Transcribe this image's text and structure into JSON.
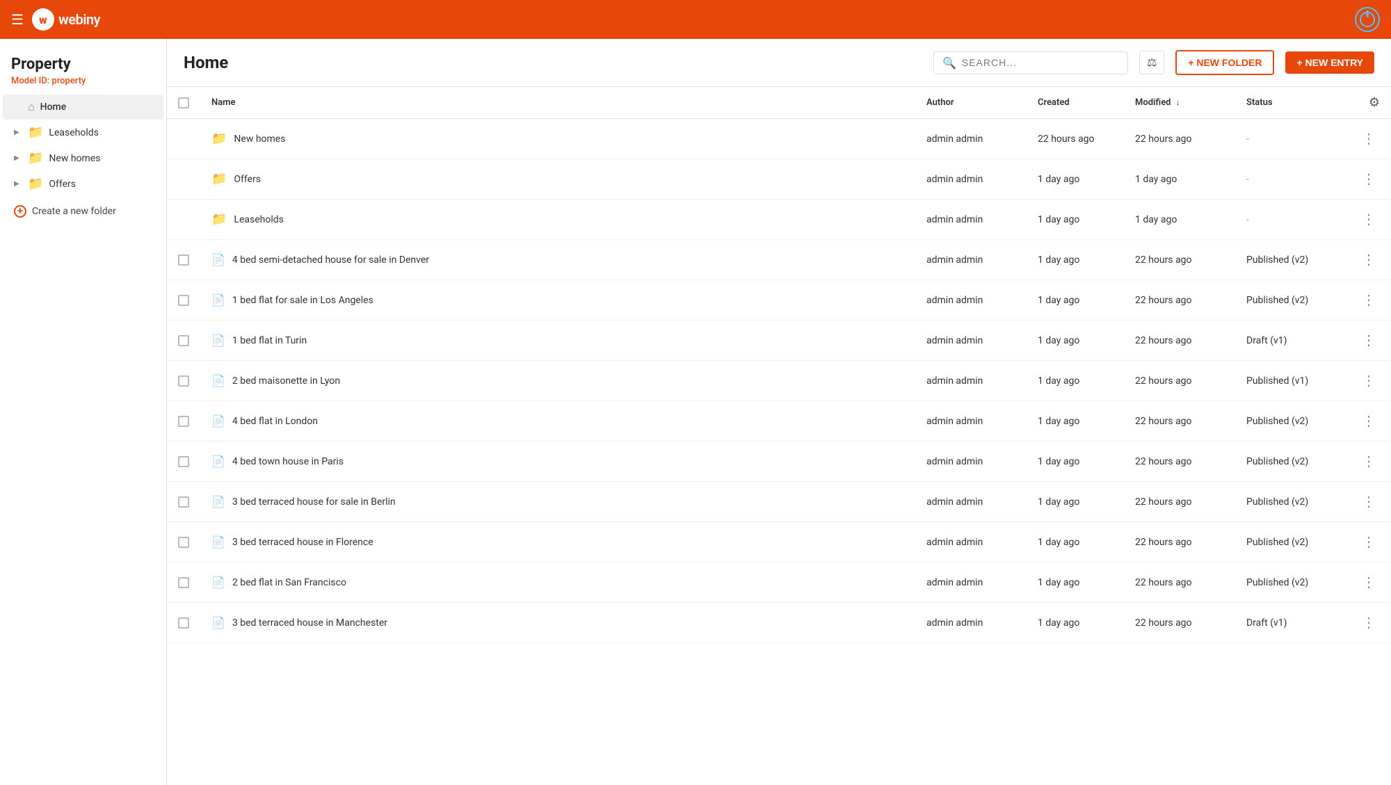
{
  "app": {
    "nav": {
      "logo_letter": "w",
      "logo_text": "webiny"
    }
  },
  "sidebar": {
    "title": "Property",
    "model_label": "Model ID:",
    "model_id": "property",
    "items": [
      {
        "id": "home",
        "label": "Home",
        "icon": "home",
        "active": true
      },
      {
        "id": "leaseholds",
        "label": "Leaseholds",
        "icon": "folder",
        "active": false
      },
      {
        "id": "new-homes",
        "label": "New homes",
        "icon": "folder",
        "active": false
      },
      {
        "id": "offers",
        "label": "Offers",
        "icon": "folder",
        "active": false
      }
    ],
    "create_folder_label": "Create a new folder"
  },
  "header": {
    "title": "Home",
    "search_placeholder": "SEARCH...",
    "btn_new_folder": "+ NEW FOLDER",
    "btn_new_entry": "+ NEW ENTRY"
  },
  "table": {
    "columns": {
      "name": "Name",
      "author": "Author",
      "created": "Created",
      "modified": "Modified",
      "status": "Status"
    },
    "folders": [
      {
        "id": "f1",
        "name": "New homes",
        "author": "admin admin",
        "created": "22 hours ago",
        "modified": "22 hours ago",
        "status": "-"
      },
      {
        "id": "f2",
        "name": "Offers",
        "author": "admin admin",
        "created": "1 day ago",
        "modified": "1 day ago",
        "status": "-"
      },
      {
        "id": "f3",
        "name": "Leaseholds",
        "author": "admin admin",
        "created": "1 day ago",
        "modified": "1 day ago",
        "status": "-"
      }
    ],
    "entries": [
      {
        "id": "e1",
        "name": "4 bed semi-detached house for sale in Denver",
        "author": "admin admin",
        "created": "1 day ago",
        "modified": "22 hours ago",
        "status": "Published (v2)"
      },
      {
        "id": "e2",
        "name": "1 bed flat for sale in Los Angeles",
        "author": "admin admin",
        "created": "1 day ago",
        "modified": "22 hours ago",
        "status": "Published (v2)"
      },
      {
        "id": "e3",
        "name": "1 bed flat in Turin",
        "author": "admin admin",
        "created": "1 day ago",
        "modified": "22 hours ago",
        "status": "Draft (v1)"
      },
      {
        "id": "e4",
        "name": "2 bed maisonette in Lyon",
        "author": "admin admin",
        "created": "1 day ago",
        "modified": "22 hours ago",
        "status": "Published (v1)"
      },
      {
        "id": "e5",
        "name": "4 bed flat in London",
        "author": "admin admin",
        "created": "1 day ago",
        "modified": "22 hours ago",
        "status": "Published (v2)"
      },
      {
        "id": "e6",
        "name": "4 bed town house in Paris",
        "author": "admin admin",
        "created": "1 day ago",
        "modified": "22 hours ago",
        "status": "Published (v2)"
      },
      {
        "id": "e7",
        "name": "3 bed terraced house for sale in Berlin",
        "author": "admin admin",
        "created": "1 day ago",
        "modified": "22 hours ago",
        "status": "Published (v2)"
      },
      {
        "id": "e8",
        "name": "3 bed terraced house in Florence",
        "author": "admin admin",
        "created": "1 day ago",
        "modified": "22 hours ago",
        "status": "Published (v2)"
      },
      {
        "id": "e9",
        "name": "2 bed flat in San Francisco",
        "author": "admin admin",
        "created": "1 day ago",
        "modified": "22 hours ago",
        "status": "Published (v2)"
      },
      {
        "id": "e10",
        "name": "3 bed terraced house in Manchester",
        "author": "admin admin",
        "created": "1 day ago",
        "modified": "22 hours ago",
        "status": "Draft (v1)"
      }
    ]
  }
}
